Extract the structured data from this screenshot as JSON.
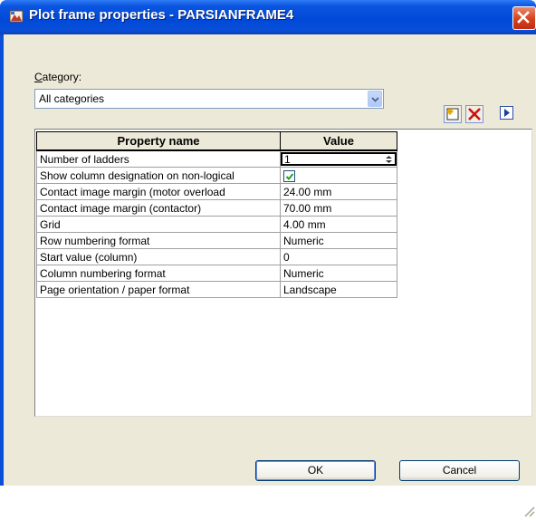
{
  "window": {
    "title": "Plot frame properties - PARSIANFRAME4",
    "app_icon": "app-icon",
    "close_icon": "close-icon"
  },
  "category": {
    "label": "Category:",
    "selected": "All categories",
    "dropdown_icon": "chevron-down-icon"
  },
  "toolbar": {
    "new_icon": "new-item-icon",
    "delete_icon": "delete-icon",
    "more_icon": "arrow-right-icon"
  },
  "grid": {
    "columns": [
      "Property name",
      "Value"
    ],
    "rows": [
      {
        "name": "Number of ladders",
        "value": "1",
        "editor": "spinner"
      },
      {
        "name": "Show column designation on non-logical",
        "value": "",
        "editor": "checkbox",
        "checked": true
      },
      {
        "name": "Contact image margin (motor overload",
        "value": "24.00 mm"
      },
      {
        "name": "Contact image margin (contactor)",
        "value": "70.00 mm"
      },
      {
        "name": "Grid",
        "value": "4.00 mm"
      },
      {
        "name": "Row numbering format",
        "value": "Numeric"
      },
      {
        "name": "Start value (column)",
        "value": "0"
      },
      {
        "name": "Column numbering format",
        "value": "Numeric"
      },
      {
        "name": "Page orientation / paper format",
        "value": "Landscape"
      }
    ]
  },
  "buttons": {
    "ok": "OK",
    "cancel": "Cancel"
  },
  "colors": {
    "titlebar": "#0049d8",
    "dialog_bg": "#ece9d8",
    "close_red": "#d6401b",
    "check_green": "#21a121"
  }
}
